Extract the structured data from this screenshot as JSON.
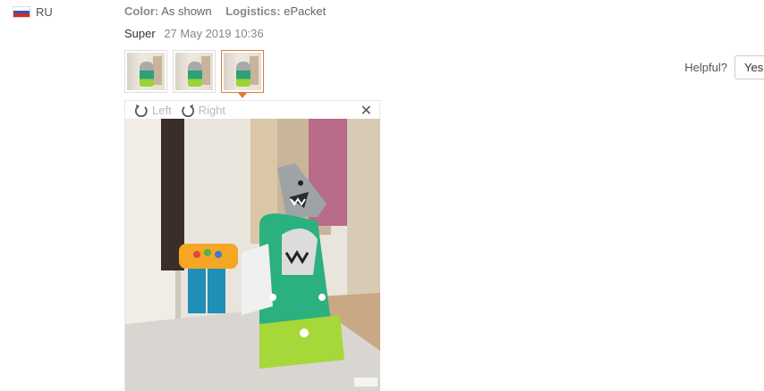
{
  "reviewer": {
    "country": "RU",
    "flag_icon": "russia-flag-icon"
  },
  "attributes": {
    "color_label": "Color:",
    "color_value": "As shown",
    "logistics_label": "Logistics:",
    "logistics_value": "ePacket"
  },
  "review": {
    "text": "Super",
    "date": "27 May 2019 10:36"
  },
  "thumbnails": {
    "count": 3,
    "active_index": 2
  },
  "helpful": {
    "label": "Helpful?",
    "yes_label": "Yes"
  },
  "viewer": {
    "rotate_left_label": "Left",
    "rotate_right_label": "Right",
    "close_glyph": "✕"
  },
  "colors": {
    "accent": "#e07b39",
    "muted": "#bbbbbb"
  }
}
